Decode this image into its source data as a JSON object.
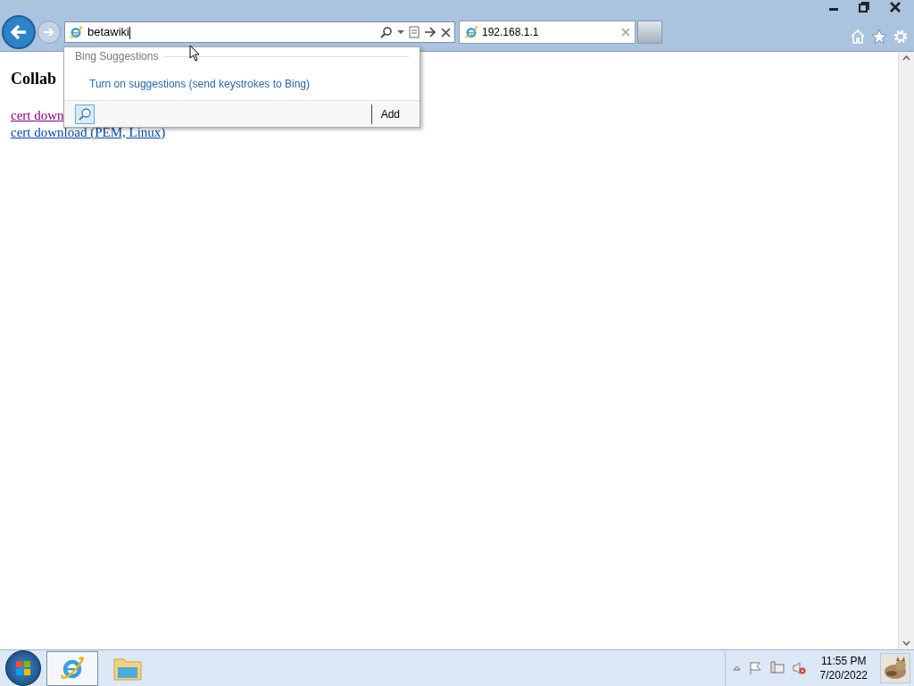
{
  "browser": {
    "address_bar": {
      "value": "betawiki"
    },
    "tabs": [
      {
        "title": "192.168.1.1",
        "selected": true
      }
    ]
  },
  "suggestions": {
    "header": "Bing Suggestions",
    "link": "Turn on suggestions (send keystrokes to Bing)",
    "add_button": "Add"
  },
  "page": {
    "heading": "Collab",
    "links": [
      {
        "text": "cert down",
        "visited": true
      },
      {
        "text": "cert download (PEM, Linux)",
        "visited": false
      }
    ]
  },
  "taskbar": {
    "apps": [
      {
        "kind": "browser",
        "selected": true
      },
      {
        "kind": "folder",
        "selected": false
      }
    ],
    "time": "11:55 PM",
    "date": "7/20/2022"
  }
}
